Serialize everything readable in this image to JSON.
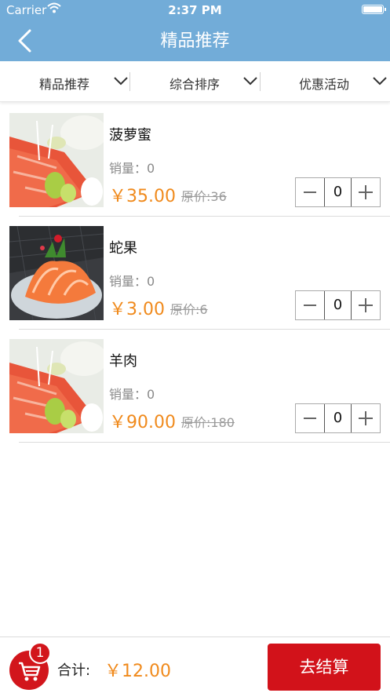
{
  "status_bar": {
    "carrier": "Carrier",
    "time": "2:37 PM"
  },
  "header": {
    "title": "精品推荐"
  },
  "filters": [
    {
      "label": "精品推荐"
    },
    {
      "label": "综合排序"
    },
    {
      "label": "优惠活动"
    }
  ],
  "products": [
    {
      "name": "菠萝蜜",
      "sales_label": "销量：0",
      "price": "￥35.00",
      "original_price": "原价:36",
      "quantity": "0"
    },
    {
      "name": "蛇果",
      "sales_label": "销量：0",
      "price": "￥3.00",
      "original_price": "原价:6",
      "quantity": "0"
    },
    {
      "name": "羊肉",
      "sales_label": "销量：0",
      "price": "￥90.00",
      "original_price": "原价:180",
      "quantity": "0"
    }
  ],
  "footer": {
    "cart_count": "1",
    "total_label": "合计:",
    "total_value": "￥12.00",
    "checkout_label": "去结算"
  },
  "colors": {
    "header": "#72acd8",
    "accent_red": "#d2121a",
    "price_orange": "#f08a1c"
  }
}
